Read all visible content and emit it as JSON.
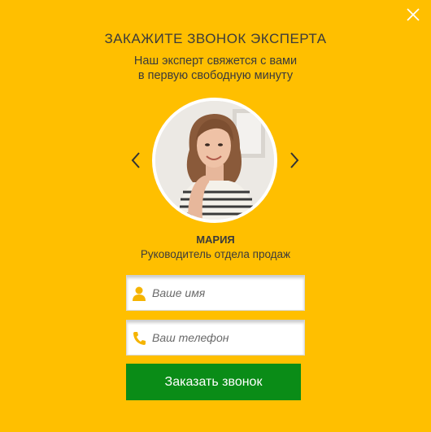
{
  "modal": {
    "title": "ЗАКАЖИТЕ ЗВОНОК ЭКСПЕРТА",
    "subtitle_line1": "Наш эксперт свяжется с вами",
    "subtitle_line2": "в первую свободную минуту"
  },
  "expert": {
    "name": "МАРИЯ",
    "role": "Руководитель отдела продаж"
  },
  "form": {
    "name_placeholder": "Ваше имя",
    "phone_placeholder": "Ваш телефон",
    "submit_label": "Заказать звонок"
  },
  "icons": {
    "close": "close-icon",
    "prev": "chevron-left-icon",
    "next": "chevron-right-icon",
    "user": "user-icon",
    "phone": "phone-icon"
  },
  "colors": {
    "background": "#ffbf00",
    "button": "#0a8c17",
    "icon_accent": "#f5b400",
    "text": "#3b3b3b"
  }
}
